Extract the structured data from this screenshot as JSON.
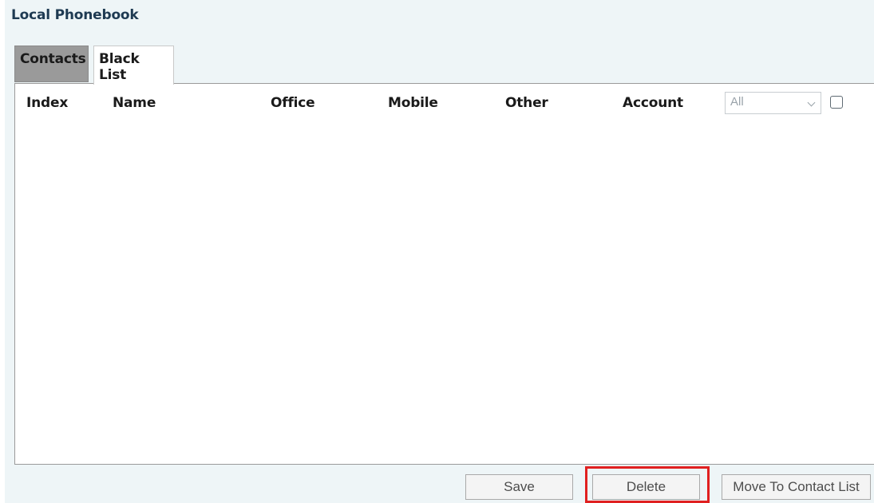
{
  "page": {
    "title": "Local Phonebook"
  },
  "tabs": [
    {
      "label": "Contacts",
      "active": false
    },
    {
      "label": "Black List",
      "active": true
    }
  ],
  "table": {
    "columns": [
      "Index",
      "Name",
      "Office",
      "Mobile",
      "Other",
      "Account"
    ],
    "rows": [],
    "account_filter": {
      "value": "All"
    },
    "select_all_checked": false
  },
  "actions": {
    "save_label": "Save",
    "delete_label": "Delete",
    "move_label": "Move To Contact List"
  },
  "colors": {
    "title": "#1e3a52",
    "active_tab": "#ffffff",
    "inactive_tab": "#9a9a9a",
    "background": "#eef5f7",
    "highlight": "#e02020"
  }
}
